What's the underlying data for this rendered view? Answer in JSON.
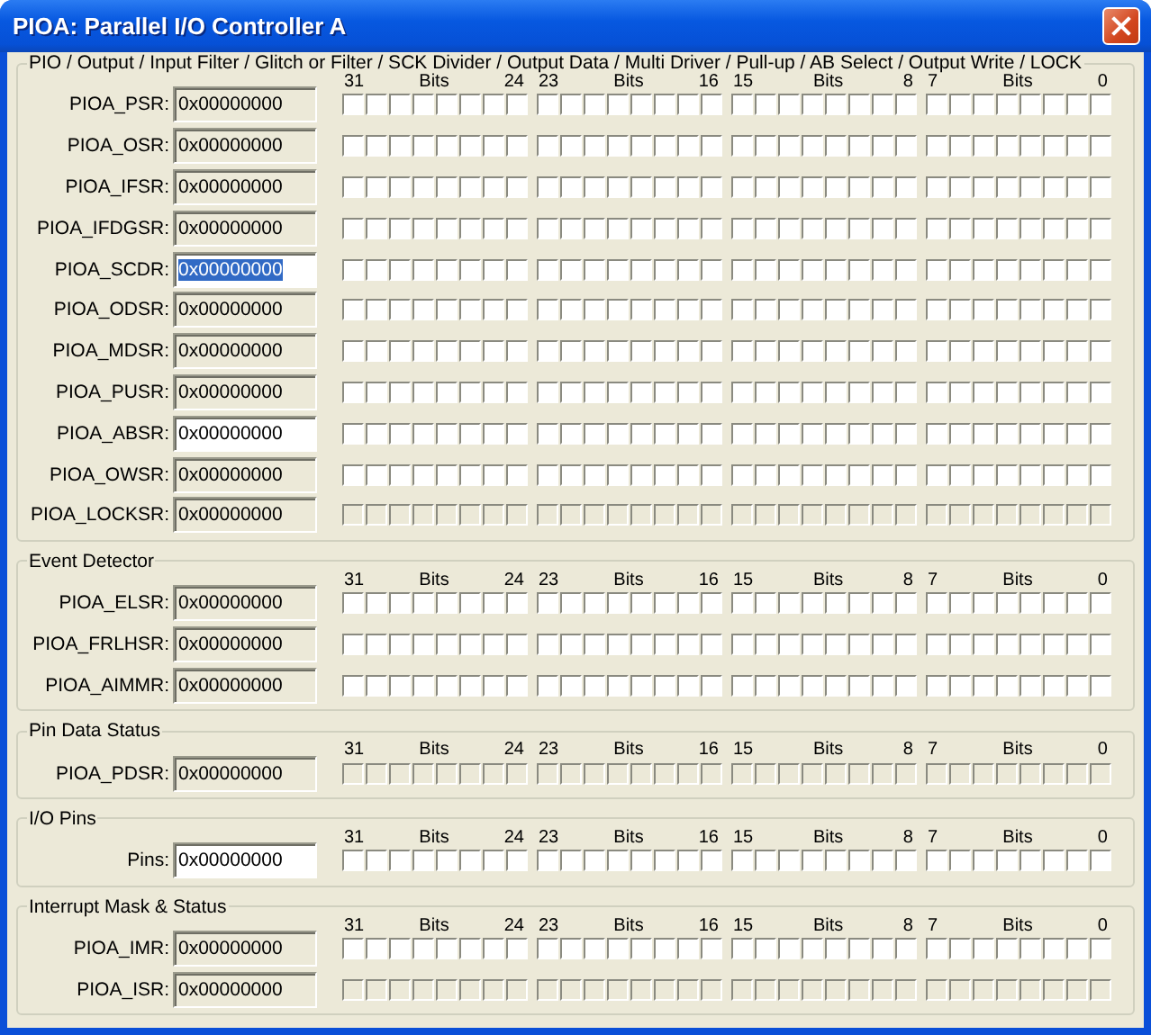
{
  "window": {
    "title": "PIOA: Parallel I/O Controller A"
  },
  "groups": [
    {
      "title": "PIO / Output / Input Filter / Glitch or Filter / SCK Divider / Output Data / Multi Driver / Pull-up / AB Select / Output Write / LOCK",
      "bit_header": [
        "31",
        "Bits",
        "24",
        "23",
        "Bits",
        "16",
        "15",
        "Bits",
        "8",
        "7",
        "Bits",
        "0"
      ],
      "rows": [
        {
          "label": "PIOA_PSR:",
          "value": "0x00000000",
          "editable": false,
          "value_selected": false,
          "bits_disabled": false,
          "checked": [
            false,
            false,
            false,
            false,
            false,
            false,
            false,
            false,
            false,
            false,
            false,
            false,
            false,
            false,
            false,
            false,
            false,
            false,
            false,
            false,
            false,
            false,
            false,
            false,
            false,
            false,
            false,
            false,
            false,
            false,
            false,
            false
          ]
        },
        {
          "label": "PIOA_OSR:",
          "value": "0x00000000",
          "editable": false,
          "value_selected": false,
          "bits_disabled": false,
          "checked": [
            false,
            false,
            false,
            false,
            false,
            false,
            false,
            false,
            false,
            false,
            false,
            false,
            false,
            false,
            false,
            false,
            false,
            false,
            false,
            false,
            false,
            false,
            false,
            false,
            false,
            false,
            false,
            false,
            false,
            false,
            false,
            false
          ]
        },
        {
          "label": "PIOA_IFSR:",
          "value": "0x00000000",
          "editable": false,
          "value_selected": false,
          "bits_disabled": false,
          "checked": [
            false,
            false,
            false,
            false,
            false,
            false,
            false,
            false,
            false,
            false,
            false,
            false,
            false,
            false,
            false,
            false,
            false,
            false,
            false,
            false,
            false,
            false,
            false,
            false,
            false,
            false,
            false,
            false,
            false,
            false,
            false,
            false
          ]
        },
        {
          "label": "PIOA_IFDGSR:",
          "value": "0x00000000",
          "editable": false,
          "value_selected": false,
          "bits_disabled": false,
          "checked": [
            false,
            false,
            false,
            false,
            false,
            false,
            false,
            false,
            false,
            false,
            false,
            false,
            false,
            false,
            false,
            false,
            false,
            false,
            false,
            false,
            false,
            false,
            false,
            false,
            false,
            false,
            false,
            false,
            false,
            false,
            false,
            false
          ]
        },
        {
          "label": "PIOA_SCDR:",
          "value": "0x00000000",
          "editable": true,
          "value_selected": true,
          "bits_disabled": false,
          "checked": [
            false,
            false,
            false,
            false,
            false,
            false,
            false,
            false,
            false,
            false,
            false,
            false,
            false,
            false,
            false,
            false,
            false,
            false,
            false,
            false,
            false,
            false,
            false,
            false,
            false,
            false,
            false,
            false,
            false,
            false,
            false,
            false
          ]
        },
        {
          "label": "PIOA_ODSR:",
          "value": "0x00000000",
          "editable": false,
          "value_selected": false,
          "bits_disabled": false,
          "checked": [
            false,
            false,
            false,
            false,
            false,
            false,
            false,
            false,
            false,
            false,
            false,
            false,
            false,
            false,
            false,
            false,
            false,
            false,
            false,
            false,
            false,
            false,
            false,
            false,
            false,
            false,
            false,
            false,
            false,
            false,
            false,
            false
          ]
        },
        {
          "label": "PIOA_MDSR:",
          "value": "0x00000000",
          "editable": false,
          "value_selected": false,
          "bits_disabled": false,
          "checked": [
            false,
            false,
            false,
            false,
            false,
            false,
            false,
            false,
            false,
            false,
            false,
            false,
            false,
            false,
            false,
            false,
            false,
            false,
            false,
            false,
            false,
            false,
            false,
            false,
            false,
            false,
            false,
            false,
            false,
            false,
            false,
            false
          ]
        },
        {
          "label": "PIOA_PUSR:",
          "value": "0x00000000",
          "editable": false,
          "value_selected": false,
          "bits_disabled": false,
          "checked": [
            false,
            false,
            false,
            false,
            false,
            false,
            false,
            false,
            false,
            false,
            false,
            false,
            false,
            false,
            false,
            false,
            false,
            false,
            false,
            false,
            false,
            false,
            false,
            false,
            false,
            false,
            false,
            false,
            false,
            false,
            false,
            false
          ]
        },
        {
          "label": "PIOA_ABSR:",
          "value": "0x00000000",
          "editable": true,
          "value_selected": false,
          "bits_disabled": false,
          "checked": [
            false,
            false,
            false,
            false,
            false,
            false,
            false,
            false,
            false,
            false,
            false,
            false,
            false,
            false,
            false,
            false,
            false,
            false,
            false,
            false,
            false,
            false,
            false,
            false,
            false,
            false,
            false,
            false,
            false,
            false,
            false,
            false
          ]
        },
        {
          "label": "PIOA_OWSR:",
          "value": "0x00000000",
          "editable": false,
          "value_selected": false,
          "bits_disabled": false,
          "checked": [
            false,
            false,
            false,
            false,
            false,
            false,
            false,
            false,
            false,
            false,
            false,
            false,
            false,
            false,
            false,
            false,
            false,
            false,
            false,
            false,
            false,
            false,
            false,
            false,
            false,
            false,
            false,
            false,
            false,
            false,
            false,
            false
          ]
        },
        {
          "label": "PIOA_LOCKSR:",
          "value": "0x00000000",
          "editable": false,
          "value_selected": false,
          "bits_disabled": true,
          "checked": [
            false,
            false,
            false,
            false,
            false,
            false,
            false,
            false,
            false,
            false,
            false,
            false,
            false,
            false,
            false,
            false,
            false,
            false,
            false,
            false,
            false,
            false,
            false,
            false,
            false,
            false,
            false,
            false,
            false,
            false,
            false,
            false
          ]
        }
      ]
    },
    {
      "title": "Event Detector",
      "bit_header": [
        "31",
        "Bits",
        "24",
        "23",
        "Bits",
        "16",
        "15",
        "Bits",
        "8",
        "7",
        "Bits",
        "0"
      ],
      "rows": [
        {
          "label": "PIOA_ELSR:",
          "value": "0x00000000",
          "editable": false,
          "value_selected": false,
          "bits_disabled": false,
          "checked": [
            false,
            false,
            false,
            false,
            false,
            false,
            false,
            false,
            false,
            false,
            false,
            false,
            false,
            false,
            false,
            false,
            false,
            false,
            false,
            false,
            false,
            false,
            false,
            false,
            false,
            false,
            false,
            false,
            false,
            false,
            false,
            false
          ]
        },
        {
          "label": "PIOA_FRLHSR:",
          "value": "0x00000000",
          "editable": false,
          "value_selected": false,
          "bits_disabled": false,
          "checked": [
            false,
            false,
            false,
            false,
            false,
            false,
            false,
            false,
            false,
            false,
            false,
            false,
            false,
            false,
            false,
            false,
            false,
            false,
            false,
            false,
            false,
            false,
            false,
            false,
            false,
            false,
            false,
            false,
            false,
            false,
            false,
            false
          ]
        },
        {
          "label": "PIOA_AIMMR:",
          "value": "0x00000000",
          "editable": false,
          "value_selected": false,
          "bits_disabled": false,
          "checked": [
            false,
            false,
            false,
            false,
            false,
            false,
            false,
            false,
            false,
            false,
            false,
            false,
            false,
            false,
            false,
            false,
            false,
            false,
            false,
            false,
            false,
            false,
            false,
            false,
            false,
            false,
            false,
            false,
            false,
            false,
            false,
            false
          ]
        }
      ]
    },
    {
      "title": "Pin Data Status",
      "bit_header": [
        "31",
        "Bits",
        "24",
        "23",
        "Bits",
        "16",
        "15",
        "Bits",
        "8",
        "7",
        "Bits",
        "0"
      ],
      "rows": [
        {
          "label": "PIOA_PDSR:",
          "value": "0x00000000",
          "editable": false,
          "value_selected": false,
          "bits_disabled": true,
          "checked": [
            false,
            false,
            false,
            false,
            false,
            false,
            false,
            false,
            false,
            false,
            false,
            false,
            false,
            false,
            false,
            false,
            false,
            false,
            false,
            false,
            false,
            false,
            false,
            false,
            false,
            false,
            false,
            false,
            false,
            false,
            false,
            false
          ]
        }
      ]
    },
    {
      "title": "I/O Pins",
      "bit_header": [
        "31",
        "Bits",
        "24",
        "23",
        "Bits",
        "16",
        "15",
        "Bits",
        "8",
        "7",
        "Bits",
        "0"
      ],
      "rows": [
        {
          "label": "Pins:",
          "value": "0x00000000",
          "editable": true,
          "value_selected": false,
          "bits_disabled": false,
          "checked": [
            false,
            false,
            false,
            false,
            false,
            false,
            false,
            false,
            false,
            false,
            false,
            false,
            false,
            false,
            false,
            false,
            false,
            false,
            false,
            false,
            false,
            false,
            false,
            false,
            false,
            false,
            false,
            false,
            false,
            false,
            false,
            false
          ]
        }
      ]
    },
    {
      "title": "Interrupt Mask & Status",
      "bit_header": [
        "31",
        "Bits",
        "24",
        "23",
        "Bits",
        "16",
        "15",
        "Bits",
        "8",
        "7",
        "Bits",
        "0"
      ],
      "rows": [
        {
          "label": "PIOA_IMR:",
          "value": "0x00000000",
          "editable": false,
          "value_selected": false,
          "bits_disabled": false,
          "checked": [
            false,
            false,
            false,
            false,
            false,
            false,
            false,
            false,
            false,
            false,
            false,
            false,
            false,
            false,
            false,
            false,
            false,
            false,
            false,
            false,
            false,
            false,
            false,
            false,
            false,
            false,
            false,
            false,
            false,
            false,
            false,
            false
          ]
        },
        {
          "label": "PIOA_ISR:",
          "value": "0x00000000",
          "editable": false,
          "value_selected": false,
          "bits_disabled": true,
          "checked": [
            false,
            false,
            false,
            false,
            false,
            false,
            false,
            false,
            false,
            false,
            false,
            false,
            false,
            false,
            false,
            false,
            false,
            false,
            false,
            false,
            false,
            false,
            false,
            false,
            false,
            false,
            false,
            false,
            false,
            false,
            false,
            false
          ]
        }
      ]
    }
  ]
}
